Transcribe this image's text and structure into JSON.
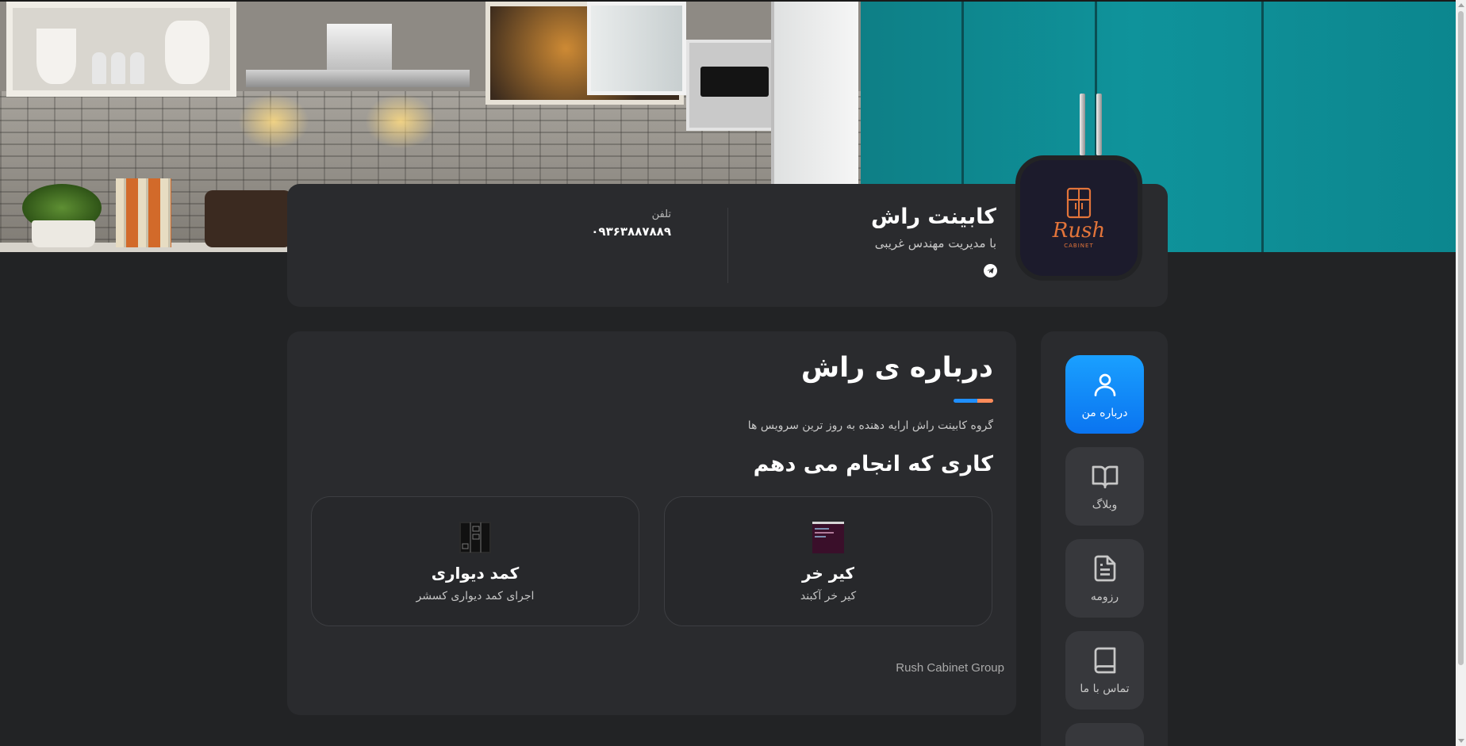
{
  "profile": {
    "brand_name": "کابینت راش",
    "brand_subtitle": "با مدیریت مهندس غریبی",
    "phone_label": "تلفن",
    "phone_value": "۰۹۳۶۳۸۸۷۸۸۹",
    "avatar_logo_word": "Rush",
    "avatar_logo_sub": "CABINET",
    "social_icon": "telegram-icon"
  },
  "nav": {
    "items": [
      {
        "label": "درباره من",
        "icon": "user-icon",
        "active": true
      },
      {
        "label": "وبلاگ",
        "icon": "book-open-icon",
        "active": false
      },
      {
        "label": "رزومه",
        "icon": "document-icon",
        "active": false
      },
      {
        "label": "تماس با ما",
        "icon": "book-icon",
        "active": false
      }
    ]
  },
  "about": {
    "title": "درباره ی راش",
    "text": "گروه کابینت راش ارایه دهنده به روز ترین سرویس ها",
    "services_title": "کاری که انجام می دهم",
    "services": [
      {
        "title": "کیر خر",
        "description": "کیر خر آکبند"
      },
      {
        "title": "کمد دیواری",
        "description": "اجرای کمد دیواری کسشر"
      }
    ]
  },
  "footer": {
    "text": "Rush Cabinet Group"
  },
  "colors": {
    "background": "#222325",
    "card": "#2a2b2e",
    "accent_blue": "#1aa0ff",
    "accent_orange": "#e2743a",
    "teal_banner": "#0f939b"
  }
}
